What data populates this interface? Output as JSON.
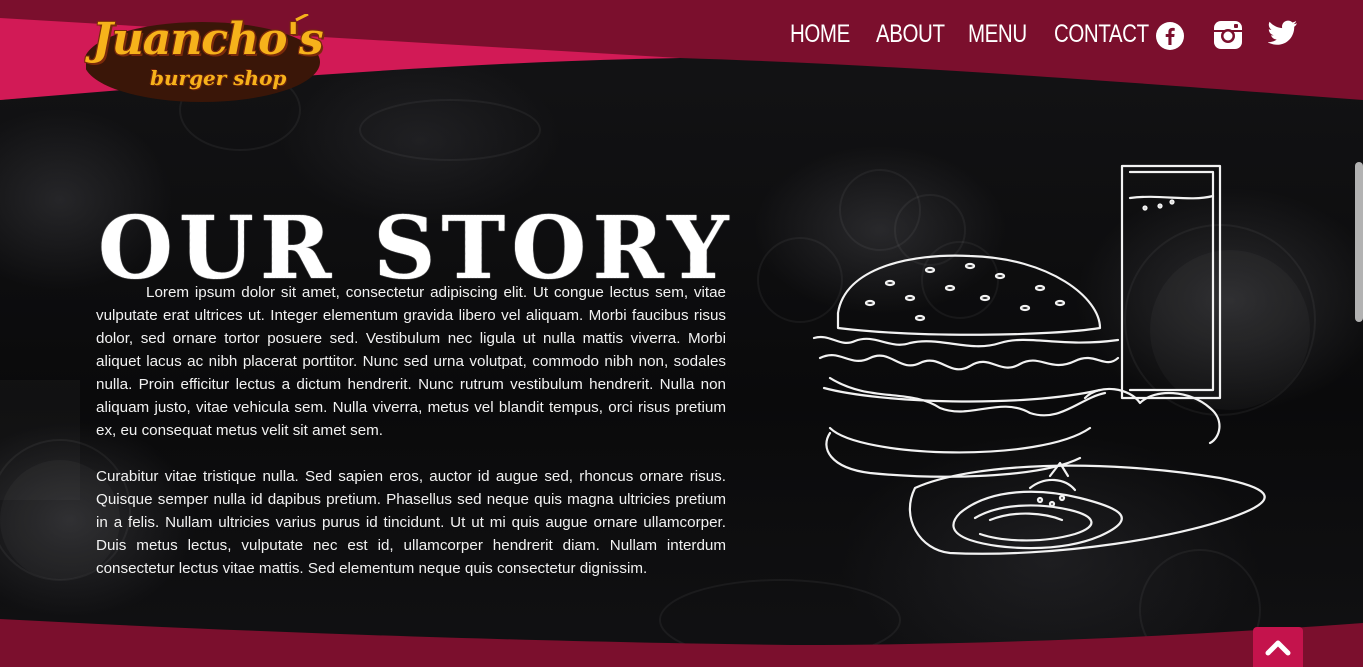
{
  "brand": {
    "name": "Juancho's",
    "tagline": "burger shop",
    "primary_color": "#7b0f2d",
    "accent_color": "#d21a56",
    "logo_color": "#f6b21b"
  },
  "nav": {
    "items": [
      {
        "label": "HOME"
      },
      {
        "label": "ABOUT"
      },
      {
        "label": "MENU"
      },
      {
        "label": "CONTACT"
      }
    ],
    "social": [
      "facebook-icon",
      "instagram-icon",
      "twitter-icon"
    ]
  },
  "page": {
    "title": "OUR STORY",
    "paragraphs": [
      "Lorem ipsum dolor sit amet, consectetur adipiscing elit. Ut congue lectus sem, vitae vulputate erat ultrices ut. Integer elementum gravida libero vel aliquam. Morbi faucibus risus dolor, sed ornare tortor posuere sed. Vestibulum nec ligula ut nulla mattis viverra. Morbi aliquet lacus ac nibh placerat porttitor. Nunc sed urna volutpat, commodo nibh non, sodales nulla. Proin efficitur lectus a dictum hendrerit. Nunc rutrum vestibulum hendrerit. Nulla non aliquam justo, vitae vehicula sem. Nulla viverra, metus vel blandit tempus, orci risus pretium ex, eu consequat metus velit sit amet sem.",
      "Curabitur vitae tristique nulla. Sed sapien eros, auctor id augue sed, rhoncus ornare risus. Quisque semper nulla id dapibus pretium. Phasellus sed neque quis magna ultricies pretium in a felis. Nullam ultricies varius purus id tincidunt. Ut ut mi quis augue ornare ullamcorper. Duis metus lectus, vulputate nec est id, ullamcorper hendrerit diam. Nullam interdum consectetur lectus vitae mattis. Sed elementum neque quis consectetur dignissim."
    ]
  },
  "back_to_top_icon": "chevron-up-icon"
}
